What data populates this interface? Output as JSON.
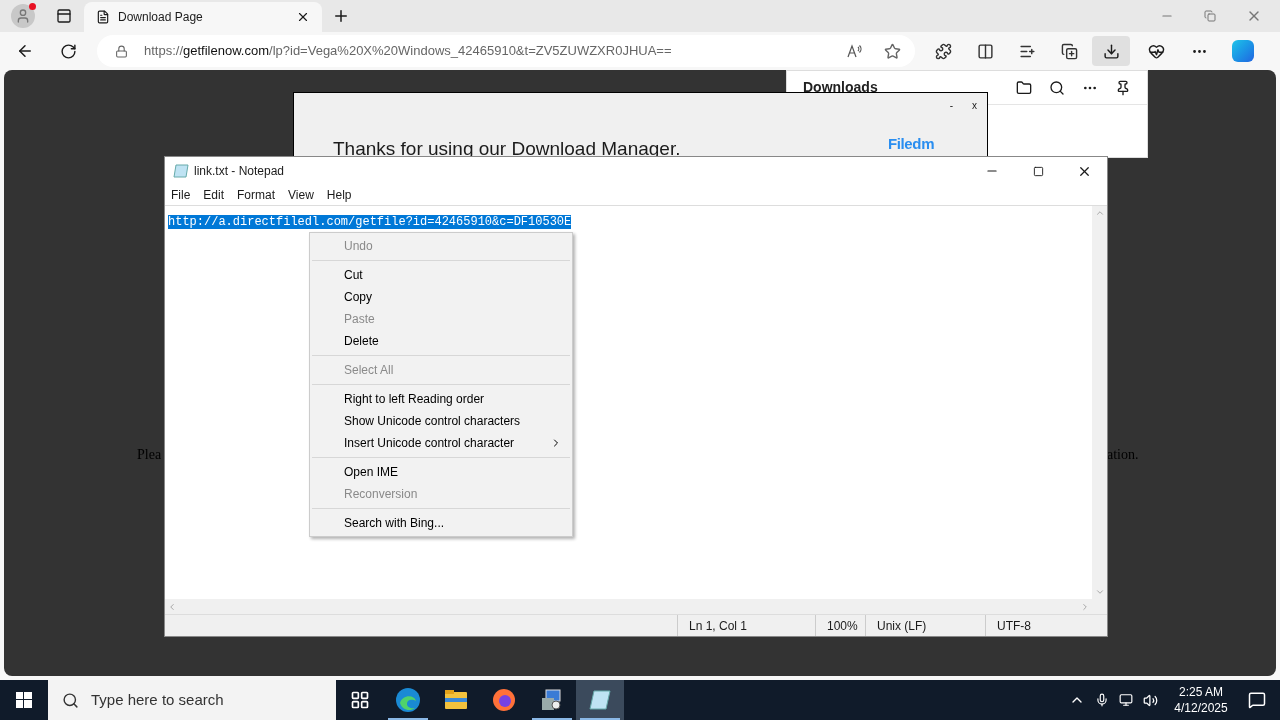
{
  "browser": {
    "tab": {
      "title": "Download Page"
    },
    "url": {
      "prefix": "https://",
      "domain": "getfilenow.com",
      "path": "/lp?id=Vega%20X%20Windows_42465910&t=ZV5ZUWZXR0JHUA=="
    }
  },
  "downloads_panel": {
    "title": "Downloads"
  },
  "page": {
    "dialog": {
      "minimize": "-",
      "close": "x",
      "message": "Thanks for using our Download Manager.",
      "logo": "Filedm"
    },
    "text_left": "Plea",
    "text_right": "ation."
  },
  "notepad": {
    "title": "link.txt - Notepad",
    "menu": [
      "File",
      "Edit",
      "Format",
      "View",
      "Help"
    ],
    "content": "http://a.directfiledl.com/getfile?id=42465910&c=DF10530E",
    "selected": true,
    "status": [
      "Ln 1, Col 1",
      "100%",
      "Unix (LF)",
      "UTF-8"
    ]
  },
  "context_menu": {
    "groups": [
      [
        {
          "label": "Undo",
          "disabled": true,
          "submenu": false
        }
      ],
      [
        {
          "label": "Cut",
          "disabled": false,
          "submenu": false
        },
        {
          "label": "Copy",
          "disabled": false,
          "submenu": false
        },
        {
          "label": "Paste",
          "disabled": true,
          "submenu": false
        },
        {
          "label": "Delete",
          "disabled": false,
          "submenu": false
        }
      ],
      [
        {
          "label": "Select All",
          "disabled": true,
          "submenu": false
        }
      ],
      [
        {
          "label": "Right to left Reading order",
          "disabled": false,
          "submenu": false
        },
        {
          "label": "Show Unicode control characters",
          "disabled": false,
          "submenu": false
        },
        {
          "label": "Insert Unicode control character",
          "disabled": false,
          "submenu": true
        }
      ],
      [
        {
          "label": "Open IME",
          "disabled": false,
          "submenu": false
        },
        {
          "label": "Reconversion",
          "disabled": true,
          "submenu": false
        }
      ],
      [
        {
          "label": "Search with Bing...",
          "disabled": false,
          "submenu": false
        }
      ]
    ]
  },
  "taskbar": {
    "search_placeholder": "Type here to search",
    "apps": [
      {
        "kind": "taskview",
        "open": false,
        "selected": false
      },
      {
        "kind": "edge",
        "open": true,
        "selected": false
      },
      {
        "kind": "explorer",
        "open": false,
        "selected": false
      },
      {
        "kind": "firefox",
        "open": false,
        "selected": false
      },
      {
        "kind": "installer",
        "open": true,
        "selected": false
      },
      {
        "kind": "notepad",
        "open": true,
        "selected": true
      }
    ],
    "time": "2:25 AM",
    "date": "4/12/2025"
  }
}
